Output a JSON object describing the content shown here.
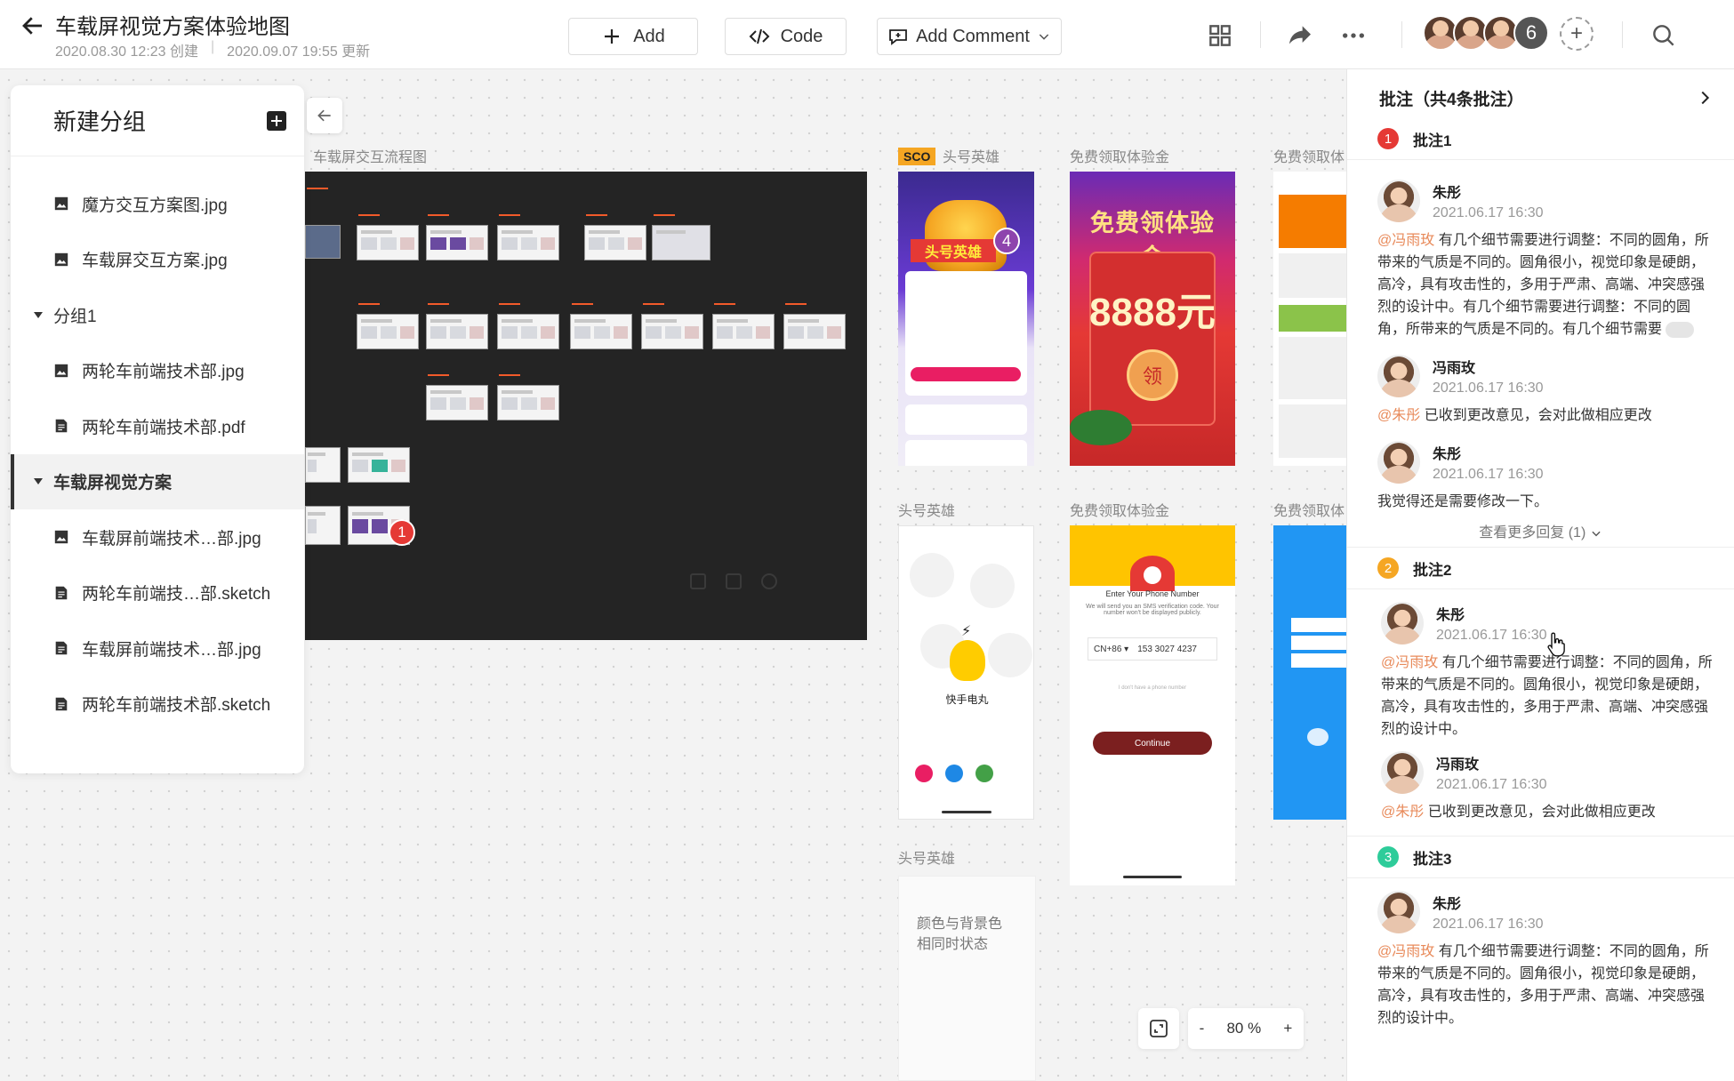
{
  "header": {
    "title": "车载屏视觉方案体验地图",
    "created": "2020.08.30 12:23 创建",
    "updated": "2020.09.07 19:55 更新",
    "add_label": "Add",
    "code_label": "Code",
    "comment_label": "Add Comment",
    "member_count": "6"
  },
  "sidebar": {
    "title": "新建分组",
    "items": [
      {
        "label": "魔方交互方案图.jpg"
      },
      {
        "label": "车载屏交互方案.jpg"
      },
      {
        "label": "分组1"
      },
      {
        "label": "两轮车前端技术部.jpg"
      },
      {
        "label": "两轮车前端技术部.pdf"
      },
      {
        "label": "车载屏视觉方案"
      },
      {
        "label": "车载屏前端技术…部.jpg"
      },
      {
        "label": "两轮车前端技…部.sketch"
      },
      {
        "label": "车载屏前端技术…部.jpg"
      },
      {
        "label": "两轮车前端技术部.sketch"
      }
    ]
  },
  "canvas": {
    "flow_label": "车载屏交互流程图",
    "flow_marker": "1",
    "sco_badge": "SCO",
    "labels": {
      "hero1": "头号英雄",
      "trial1": "免费领取体验金",
      "trial2": "免费领取体",
      "hero2": "头号英雄",
      "trial3": "免费领取体验金",
      "trial4": "免费领取体",
      "hero3": "头号英雄"
    },
    "phone1": {
      "banner": "头号英雄",
      "marker": "4"
    },
    "phone2": {
      "headline": "免费领体验金",
      "amount": "8888元",
      "seal": "领"
    },
    "phone4": {
      "app_name": "快手电丸"
    },
    "phone5": {
      "title": "Enter Your Phone Number",
      "subtitle": "We will send you an SMS verification code. Your number won't be displayed publicly.",
      "country": "CN+86 ▾",
      "phone": "153 3027 4237",
      "hint": "I don't have a phone number",
      "button": "Continue"
    },
    "note_card": "颜色与背景色\n相同时状态"
  },
  "zoom": {
    "minus": "-",
    "value": "80 %",
    "plus": "+"
  },
  "comments_panel": {
    "title": "批注（共4条批注）",
    "annotations": [
      {
        "label": "批注1",
        "number": "1",
        "color": "#e53935",
        "comments": [
          {
            "name": "朱彤",
            "time": "2021.06.17 16:30",
            "mention": "@冯雨玫",
            "text": " 有几个细节需要进行调整：不同的圆角，所带来的气质是不同的。圆角很小，视觉印象是硬朗，高冷，具有攻击性的，多用于严肃、高端、冲突感强烈的设计中。有几个细节需要进行调整：不同的圆角，所带来的气质是不同的。有几个细节需要"
          },
          {
            "name": "冯雨玫",
            "time": "2021.06.17 16:30",
            "mention": "@朱彤",
            "text": " 已收到更改意见，会对此做相应更改"
          },
          {
            "name": "朱彤",
            "time": "2021.06.17 16:30",
            "mention": "",
            "text": "我觉得还是需要修改一下。"
          }
        ],
        "more": "查看更多回复 (1)"
      },
      {
        "label": "批注2",
        "number": "2",
        "color": "#f5a623",
        "comments": [
          {
            "name": "朱彤",
            "time": "2021.06.17 16:30",
            "mention": "@冯雨玫",
            "text": " 有几个细节需要进行调整：不同的圆角，所带来的气质是不同的。圆角很小，视觉印象是硬朗，高冷，具有攻击性的，多用于严肃、高端、冲突感强烈的设计中。"
          },
          {
            "name": "冯雨玫",
            "time": "2021.06.17 16:30",
            "mention": "@朱彤",
            "text": " 已收到更改意见，会对此做相应更改"
          }
        ]
      },
      {
        "label": "批注3",
        "number": "3",
        "color": "#2ecc9a",
        "comments": [
          {
            "name": "朱彤",
            "time": "2021.06.17 16:30",
            "mention": "@冯雨玫",
            "text": " 有几个细节需要进行调整：不同的圆角，所带来的气质是不同的。圆角很小，视觉印象是硬朗，高冷，具有攻击性的，多用于严肃、高端、冲突感强烈的设计中。"
          }
        ]
      }
    ]
  }
}
